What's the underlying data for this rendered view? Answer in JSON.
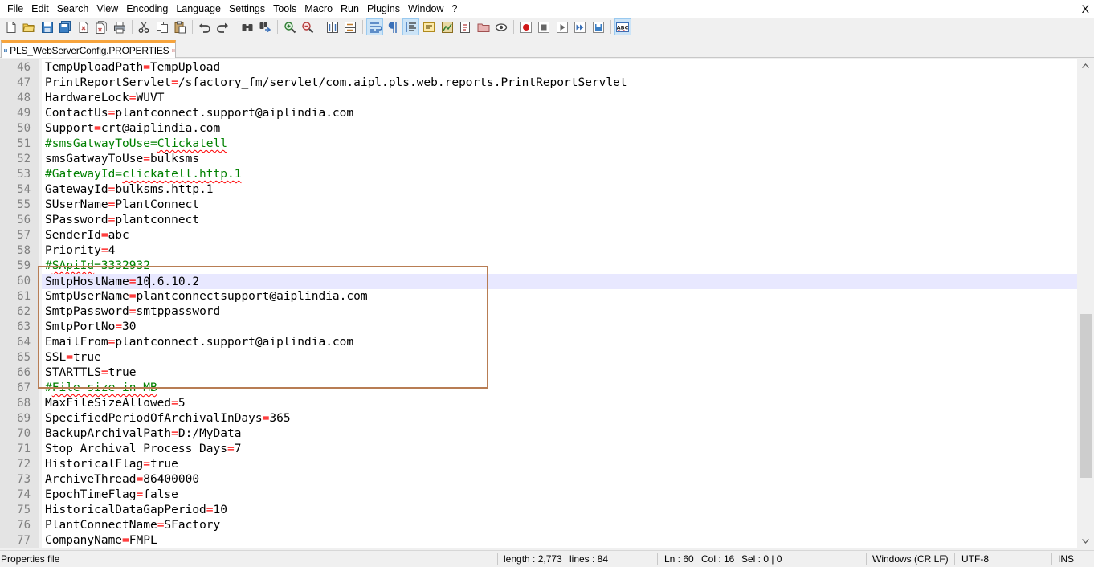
{
  "menu": {
    "items": [
      "File",
      "Edit",
      "Search",
      "View",
      "Encoding",
      "Language",
      "Settings",
      "Tools",
      "Macro",
      "Run",
      "Plugins",
      "Window",
      "?"
    ],
    "close_doc": "X"
  },
  "toolbar": {
    "buttons": [
      "new-file-icon",
      "open-file-icon",
      "save-icon",
      "save-all-icon",
      "close-icon",
      "close-all-icon",
      "print-icon",
      "cut-icon",
      "copy-icon",
      "paste-icon",
      "undo-icon",
      "redo-icon",
      "find-icon",
      "replace-icon",
      "zoom-in-icon",
      "zoom-out-icon",
      "sync-vertical-icon",
      "sync-horizontal-icon",
      "word-wrap-icon",
      "show-all-chars-icon",
      "indent-guide-icon",
      "user-language-icon",
      "doc-map-icon",
      "function-list-icon",
      "folder-workspace-icon",
      "monitor-icon",
      "record-macro-icon",
      "stop-macro-icon",
      "play-macro-icon",
      "play-multiple-icon",
      "save-macro-icon",
      "spell-check-icon"
    ],
    "spell_label": "ABC"
  },
  "tab": {
    "label": "PLS_WebServerConfig.PROPERTIES"
  },
  "editor": {
    "current_line": 60,
    "lines": [
      {
        "n": "46",
        "key": "TempUploadPath",
        "val": "TempUpload"
      },
      {
        "n": "47",
        "key": "PrintReportServlet",
        "val": "/sfactory_fm/servlet/com.aipl.pls.web.reports.PrintReportServlet"
      },
      {
        "n": "48",
        "key": "HardwareLock",
        "val": "WUVT"
      },
      {
        "n": "49",
        "key": "ContactUs",
        "val": "plantconnect.support@aiplindia.com"
      },
      {
        "n": "50",
        "key": "Support",
        "val": "crt@aiplindia.com"
      },
      {
        "n": "51",
        "comment": "#smsGatwayToUse=Clickatell"
      },
      {
        "n": "52",
        "key": "smsGatwayToUse",
        "val": "bulksms"
      },
      {
        "n": "53",
        "comment": "#GatewayId=clickatell.http.1"
      },
      {
        "n": "54",
        "key": "GatewayId",
        "val": "bulksms.http.1"
      },
      {
        "n": "55",
        "key": "SUserName",
        "val": "PlantConnect"
      },
      {
        "n": "56",
        "key": "SPassword",
        "val": "plantconnect"
      },
      {
        "n": "57",
        "key": "SenderId",
        "val": "abc"
      },
      {
        "n": "58",
        "key": "Priority",
        "val": "4"
      },
      {
        "n": "59",
        "comment": "#SApiId=3332932"
      },
      {
        "n": "60",
        "key": "SmtpHostName",
        "val": "10.6.10.2"
      },
      {
        "n": "61",
        "key": "SmtpUserName",
        "val": "plantconnectsupport@aiplindia.com"
      },
      {
        "n": "62",
        "key": "SmtpPassword",
        "val": "smtppassword"
      },
      {
        "n": "63",
        "key": "SmtpPortNo",
        "val": "30"
      },
      {
        "n": "64",
        "key": "EmailFrom",
        "val": "plantconnect.support@aiplindia.com"
      },
      {
        "n": "65",
        "key": "SSL",
        "val": "true"
      },
      {
        "n": "66",
        "key": "STARTTLS",
        "val": "true"
      },
      {
        "n": "67",
        "comment": "#File size in MB"
      },
      {
        "n": "68",
        "key": "MaxFileSizeAllowed",
        "val": "5"
      },
      {
        "n": "69",
        "key": "SpecifiedPeriodOfArchivalInDays",
        "val": "365"
      },
      {
        "n": "70",
        "key": "BackupArchivalPath",
        "val": "D:/MyData"
      },
      {
        "n": "71",
        "key": "Stop_Archival_Process_Days",
        "val": "7"
      },
      {
        "n": "72",
        "key": "HistoricalFlag",
        "val": "true"
      },
      {
        "n": "73",
        "key": "ArchiveThread",
        "val": "86400000"
      },
      {
        "n": "74",
        "key": "EpochTimeFlag",
        "val": "false"
      },
      {
        "n": "75",
        "key": "HistoricalDataGapPeriod",
        "val": "10"
      },
      {
        "n": "76",
        "key": "PlantConnectName",
        "val": "SFactory"
      },
      {
        "n": "77",
        "key": "CompanyName",
        "val": "FMPL"
      }
    ]
  },
  "status": {
    "file_type": "Properties file",
    "length": "length : 2,773",
    "lines": "lines : 84",
    "ln": "Ln : 60",
    "col": "Col : 16",
    "sel": "Sel : 0 | 0",
    "eol": "Windows (CR LF)",
    "encoding": "UTF-8",
    "mode": "INS"
  },
  "colors": {
    "accent_tab": "#f7a43c",
    "highlight_box": "#b87d54",
    "comment": "#008000",
    "operator": "#ff0000",
    "current_line": "#e8e8ff"
  }
}
